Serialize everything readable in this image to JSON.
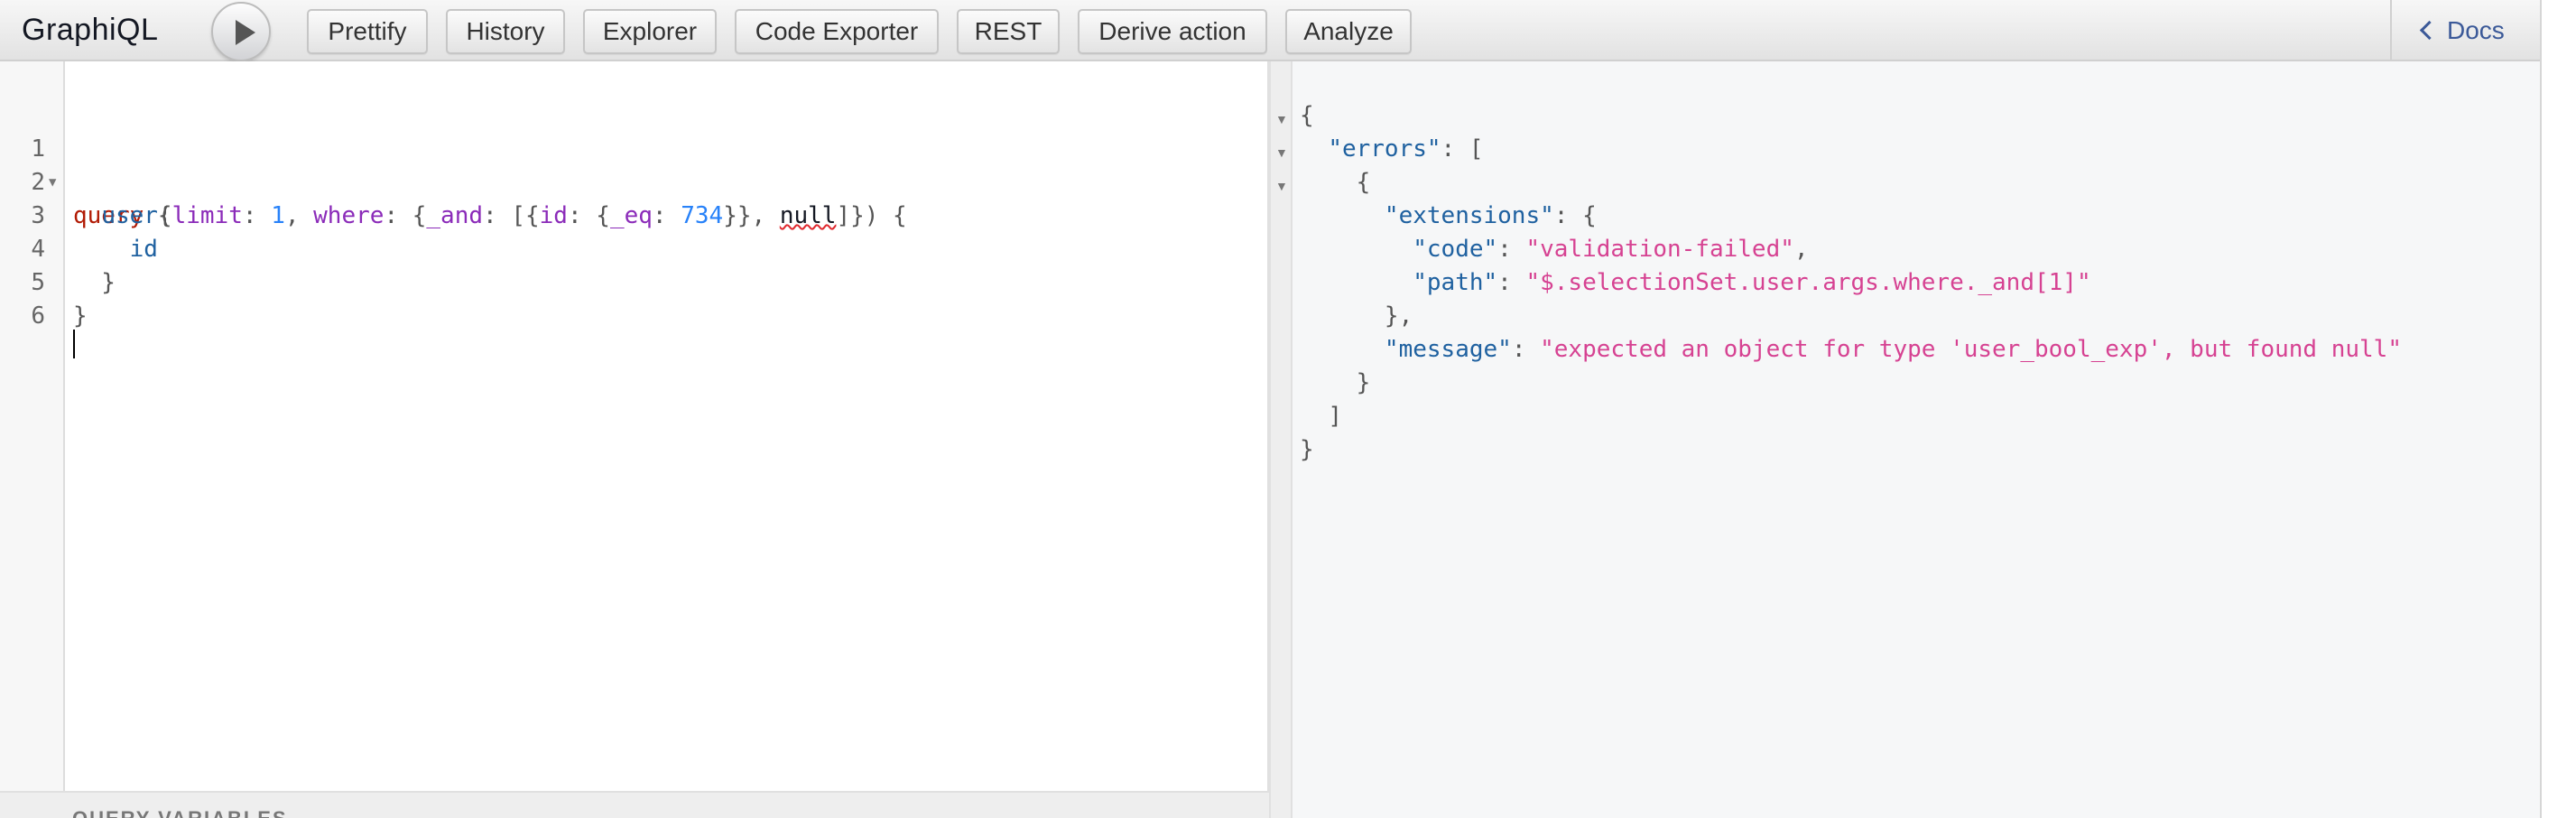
{
  "app": {
    "title": "GraphiQL"
  },
  "toolbar": {
    "buttons": [
      "Prettify",
      "History",
      "Explorer",
      "Code Exporter",
      "REST",
      "Derive action",
      "Analyze"
    ],
    "docs_label": "Docs"
  },
  "editor": {
    "line_numbers": [
      "1",
      "2",
      "3",
      "4",
      "5",
      "6"
    ],
    "tokens": {
      "query": "query",
      "open_brace": " {",
      "indent1": "  ",
      "user": "user",
      "paren_open": "(",
      "limit": "limit",
      "colon_sp": ": ",
      "one": "1",
      "comma_sp": ", ",
      "where": "where",
      "brace_open": "{",
      "and": "_and",
      "bracket_open": "[",
      "id": "id",
      "eq": "_eq",
      "val": "734",
      "close_braces": "}}",
      "null": "null",
      "close_tail": "]}) {",
      "indent2": "    ",
      "field_id": "id",
      "close_inner": "  }",
      "close_outer": "}"
    }
  },
  "variables": {
    "label": "QUERY VARIABLES"
  },
  "result": {
    "tokens": {
      "open": "{",
      "errors_key": "\"errors\"",
      "colon": ": ",
      "arr_open": "[",
      "obj_open": "{",
      "extensions_key": "\"extensions\"",
      "ext_open": "{",
      "code_key": "\"code\"",
      "code_val": "\"validation-failed\"",
      "comma": ",",
      "path_key": "\"path\"",
      "path_val": "\"$.selectionSet.user.args.where._and[1]\"",
      "ext_close": "},",
      "message_key": "\"message\"",
      "message_val": "\"expected an object for type 'user_bool_exp', but found null\"",
      "obj_close": "}",
      "arr_close": "]",
      "close": "}"
    }
  },
  "colors": {
    "keyword": "#b11a04",
    "field": "#1f61a0",
    "argument": "#8b2bb9",
    "number": "#2882f9",
    "string": "#d64292",
    "link": "#3b5998"
  },
  "icons": {
    "run": "play-icon",
    "docs": "chevron-left-icon",
    "fold": "fold-triangle-icon"
  }
}
